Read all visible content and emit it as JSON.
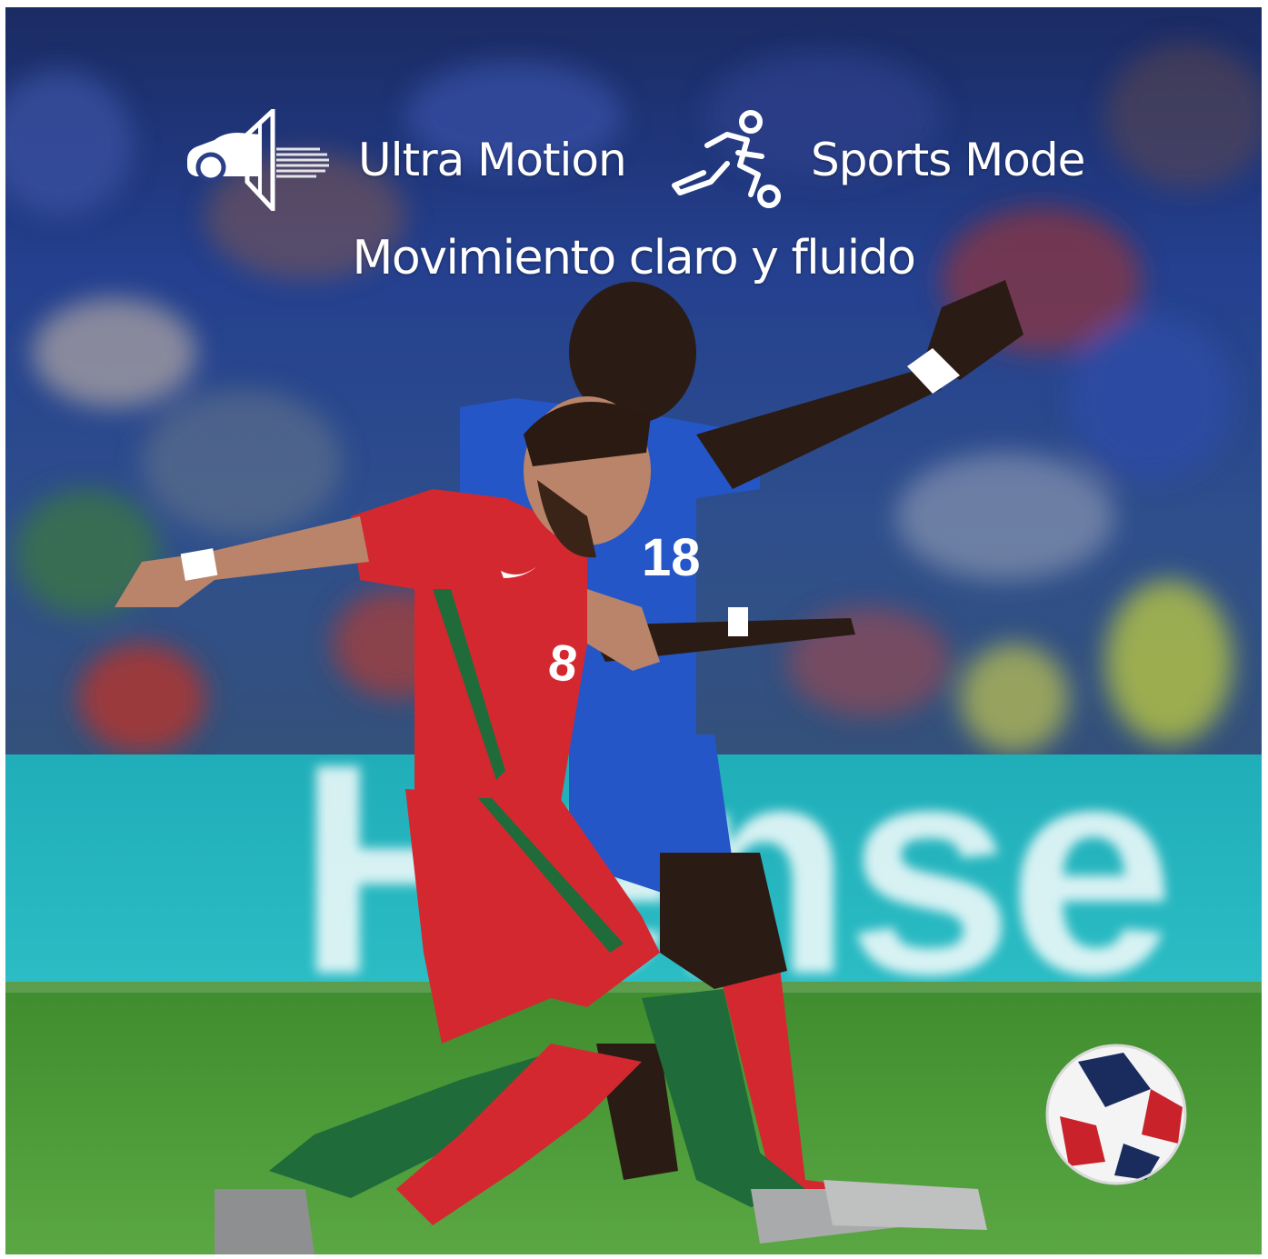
{
  "features": [
    {
      "label": "Ultra Motion",
      "icon": "ultra-motion-car-icon"
    },
    {
      "label": "Sports Mode",
      "icon": "running-player-icon"
    }
  ],
  "subtitle": "Movimiento claro y fluido",
  "photo": {
    "scene": "football-match",
    "player_red_number": "8",
    "player_blue_number": "18",
    "ad_board_text": "Hense"
  },
  "colors": {
    "text": "#ffffff",
    "crowd_blue": "#2a4aa8",
    "board_teal": "#22b3bf",
    "pitch_green": "#4f9a3a",
    "jersey_red": "#d8262d",
    "jersey_blue": "#2456c8",
    "sock_green": "#1f6b3a"
  }
}
